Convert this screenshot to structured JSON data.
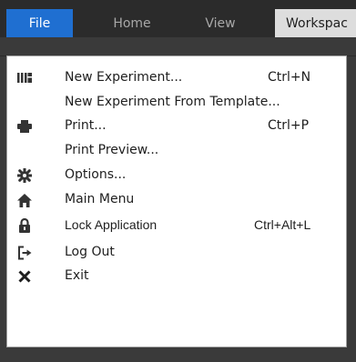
{
  "ribbon": {
    "tabs": [
      {
        "label": "File"
      },
      {
        "label": "Home"
      },
      {
        "label": "View"
      },
      {
        "label": "Workspac"
      }
    ]
  },
  "file_menu": {
    "items": [
      {
        "icon": "experiment-icon",
        "label": "New Experiment...",
        "shortcut": "Ctrl+N"
      },
      {
        "icon": "",
        "label": "New Experiment From Template...",
        "shortcut": ""
      },
      {
        "icon": "printer-icon",
        "label": "Print...",
        "shortcut": "Ctrl+P"
      },
      {
        "icon": "",
        "label": "Print Preview...",
        "shortcut": ""
      },
      {
        "icon": "gear-icon",
        "label": "Options...",
        "shortcut": ""
      },
      {
        "icon": "home-icon",
        "label": "Main Menu",
        "shortcut": ""
      },
      {
        "icon": "lock-icon",
        "label": "Lock Application",
        "shortcut": "Ctrl+Alt+L"
      },
      {
        "icon": "logout-icon",
        "label": "Log Out",
        "shortcut": ""
      },
      {
        "icon": "close-icon",
        "label": "Exit",
        "shortcut": ""
      }
    ]
  },
  "colors": {
    "accent": "#1f6fd1",
    "ribbon_background": "#2b2b2b",
    "menu_background": "#ffffff"
  }
}
